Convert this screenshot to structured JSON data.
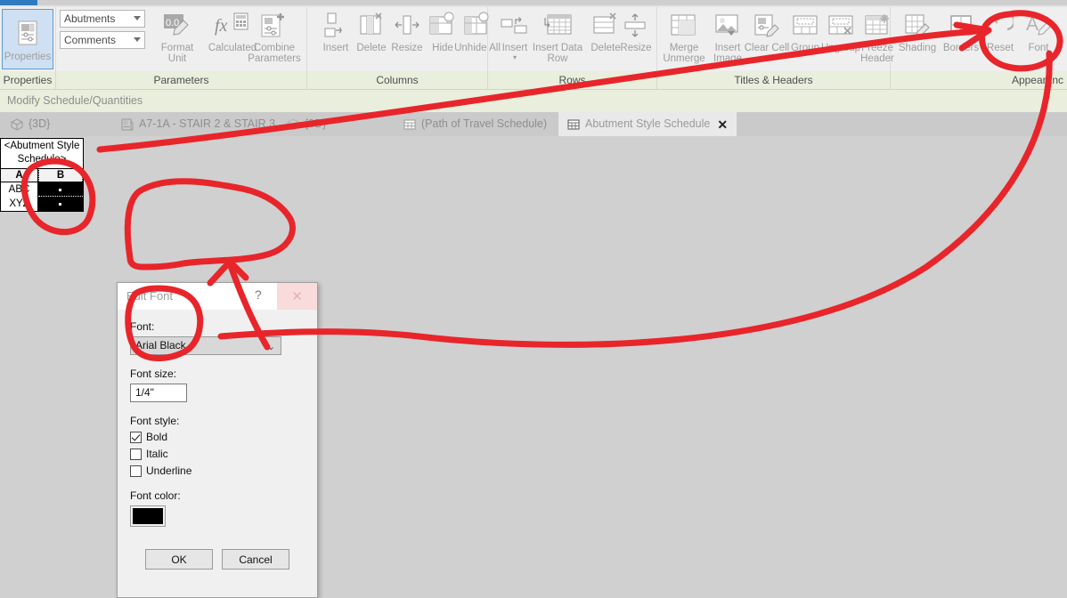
{
  "app": {
    "context_tab_label": "Modify Schedule/Quantities",
    "canvas_bg": "#d0d0d0",
    "accent_blue": "#2e7cbf",
    "annotation_color": "#e8252a"
  },
  "ribbon": {
    "groups": [
      {
        "name": "Properties",
        "label": "Properties"
      },
      {
        "name": "Parameters",
        "label": "Parameters"
      },
      {
        "name": "Columns",
        "label": "Columns"
      },
      {
        "name": "Rows",
        "label": "Rows"
      },
      {
        "name": "TitlesHeaders",
        "label": "Titles & Headers"
      },
      {
        "name": "Appearance",
        "label": "Appearanc"
      }
    ],
    "properties_button": {
      "label": "Properties",
      "icon": "properties-icon"
    },
    "combos": [
      {
        "name": "parameter-category-combo",
        "value": "Abutments"
      },
      {
        "name": "parameter-field-combo",
        "value": "Comments"
      }
    ],
    "buttons": [
      {
        "name": "format-unit",
        "label": "Format Unit",
        "icon": "format-unit-icon"
      },
      {
        "name": "calculated",
        "label": "Calculated",
        "icon": "fx-calculator-icon"
      },
      {
        "name": "combine-parameters",
        "label": "Combine Parameters",
        "icon": "combine-parameters-icon"
      },
      {
        "name": "columns-insert",
        "label": "Insert",
        "icon": "column-insert-icon"
      },
      {
        "name": "columns-delete",
        "label": "Delete",
        "icon": "column-delete-icon"
      },
      {
        "name": "columns-resize",
        "label": "Resize",
        "icon": "column-resize-icon"
      },
      {
        "name": "columns-hide",
        "label": "Hide",
        "icon": "column-hide-icon"
      },
      {
        "name": "columns-unhide-all",
        "label": "Unhide All",
        "icon": "column-unhide-icon"
      },
      {
        "name": "rows-insert",
        "label": "Insert",
        "icon": "row-insert-icon",
        "has_dropdown": true
      },
      {
        "name": "rows-insert-data-row",
        "label": "Insert Data Row",
        "icon": "insert-data-row-icon"
      },
      {
        "name": "rows-delete",
        "label": "Delete",
        "icon": "row-delete-icon"
      },
      {
        "name": "rows-resize",
        "label": "Resize",
        "icon": "row-resize-icon"
      },
      {
        "name": "merge-unmerge",
        "label": "Merge Unmerge",
        "icon": "merge-unmerge-icon"
      },
      {
        "name": "insert-image",
        "label": "Insert Image",
        "icon": "insert-image-icon"
      },
      {
        "name": "clear-cell",
        "label": "Clear Cell",
        "icon": "clear-cell-icon"
      },
      {
        "name": "group",
        "label": "Group",
        "icon": "group-icon"
      },
      {
        "name": "ungroup",
        "label": "Ungroup",
        "icon": "ungroup-icon"
      },
      {
        "name": "freeze-header",
        "label": "Freeze Header",
        "icon": "freeze-header-icon"
      },
      {
        "name": "shading",
        "label": "Shading",
        "icon": "shading-icon"
      },
      {
        "name": "borders",
        "label": "Borders",
        "icon": "borders-icon"
      },
      {
        "name": "reset",
        "label": "Reset",
        "icon": "reset-arrow-icon"
      },
      {
        "name": "font",
        "label": "Font",
        "icon": "font-A-pencil-icon"
      }
    ]
  },
  "view_tabs": [
    {
      "name": "tab-3d-1",
      "label": "{3D}",
      "icon": "cube-icon",
      "active": false
    },
    {
      "name": "tab-a71a-stair",
      "label": "A7-1A - STAIR 2 & STAIR 3",
      "icon": "sheet-icon",
      "active": false
    },
    {
      "name": "tab-3d-2",
      "label": "{3D}",
      "icon": "cube-icon",
      "active": false
    },
    {
      "name": "tab-path-of-travel",
      "label": "(Path of Travel Schedule)",
      "icon": "schedule-icon",
      "active": false
    },
    {
      "name": "tab-abutment-style",
      "label": "Abutment Style Schedule",
      "icon": "schedule-icon",
      "active": true,
      "close_label": "✕"
    }
  ],
  "schedule": {
    "title": "<Abutment Style Schedule>",
    "headers": [
      "A",
      "B"
    ],
    "rows": [
      {
        "A": "ABC",
        "B": ""
      },
      {
        "A": "XYZ",
        "B": ""
      }
    ]
  },
  "dialog": {
    "title": "Edit Font",
    "help_label": "?",
    "close_label": "✕",
    "font_label": "Font:",
    "font_value": "Arial Black",
    "font_size_label": "Font size:",
    "font_size_value": "1/4\"",
    "font_style_label": "Font style:",
    "styles": [
      {
        "name": "bold",
        "label": "Bold",
        "checked": true
      },
      {
        "name": "italic",
        "label": "Italic",
        "checked": false
      },
      {
        "name": "underline",
        "label": "Underline",
        "checked": false
      }
    ],
    "font_color_label": "Font color:",
    "font_color_value": "#000000",
    "ok_label": "OK",
    "cancel_label": "Cancel"
  }
}
